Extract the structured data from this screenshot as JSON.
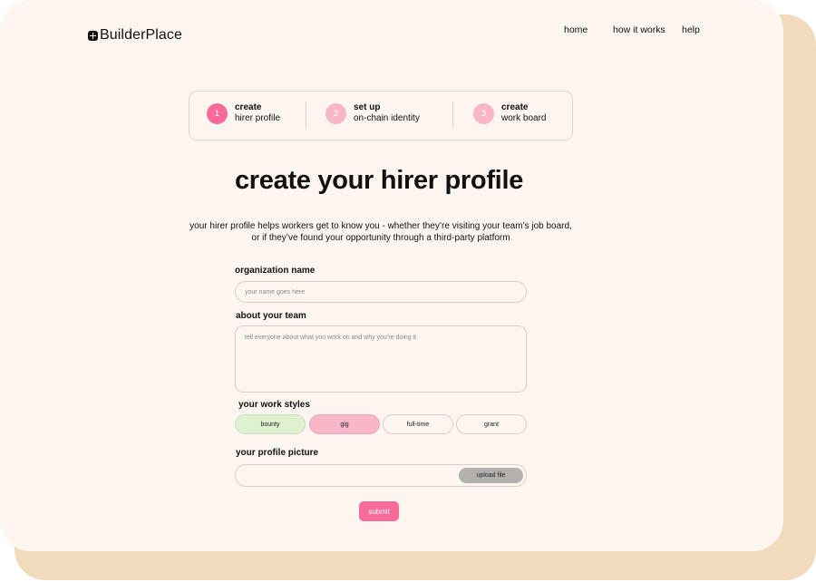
{
  "colors": {
    "background_card": "#fdf6f0",
    "shadow_card": "#f2dbbc",
    "accent_pink": "#f76b9b",
    "light_pink": "#f9b6c9",
    "light_green": "#def2cf",
    "grey_button": "#b4b0ad"
  },
  "header": {
    "logo_icon": "plus-square-icon",
    "logo_text": "BuilderPlace",
    "nav": [
      "home",
      "how it works",
      "help"
    ]
  },
  "stepper": {
    "steps": [
      {
        "number": "1",
        "title": "create",
        "subtitle": "hirer profile"
      },
      {
        "number": "2",
        "title": "set up",
        "subtitle": "on-chain identity"
      },
      {
        "number": "3",
        "title": "create",
        "subtitle": "work board"
      }
    ]
  },
  "main": {
    "title": "create your hirer profile",
    "description": "your hirer profile helps workers get to know you - whether they’re visiting your team’s job board, or if they’ve found your opportunity through a third-party platform"
  },
  "form": {
    "org_name": {
      "label": "organization name",
      "placeholder": "your name goes here"
    },
    "about": {
      "label": "about your team",
      "placeholder": "tell everyone about what you work on and why you’re doing it"
    },
    "work_styles": {
      "label": "your work styles",
      "options": [
        "bounty",
        "gig",
        "full-time",
        "grant"
      ]
    },
    "profile_picture": {
      "label": "your profile picture",
      "upload_label": "upload file"
    },
    "submit_label": "submit"
  }
}
